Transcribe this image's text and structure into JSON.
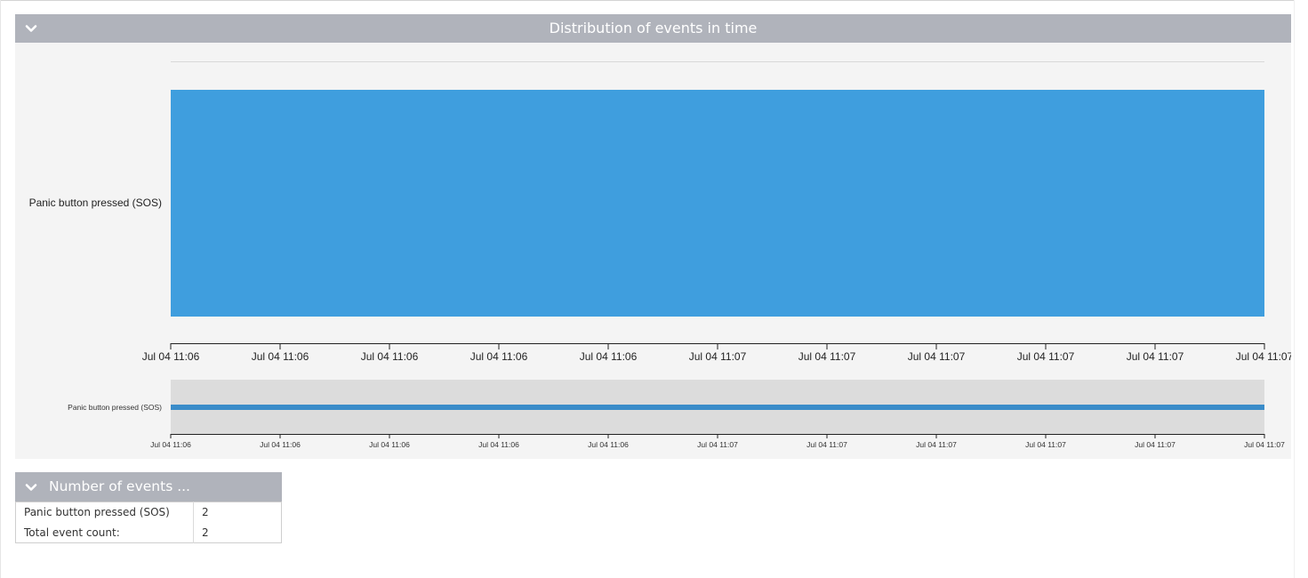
{
  "distribution_panel": {
    "title": "Distribution of events in time",
    "collapse_icon": "chevron-down-icon"
  },
  "chart_data": {
    "type": "bar",
    "orientation": "horizontal-timeline",
    "categories": [
      "Panic button pressed (SOS)"
    ],
    "series": [
      {
        "values": [
          1
        ]
      }
    ],
    "x_tick_labels": [
      "Jul 04 11:06",
      "Jul 04 11:06",
      "Jul 04 11:06",
      "Jul 04 11:06",
      "Jul 04 11:06",
      "Jul 04 11:07",
      "Jul 04 11:07",
      "Jul 04 11:07",
      "Jul 04 11:07",
      "Jul 04 11:07",
      "Jul 04 11:07"
    ],
    "navigator": {
      "categories": [
        "Panic button pressed (SOS)"
      ],
      "x_tick_labels": [
        "Jul 04 11:06",
        "Jul 04 11:06",
        "Jul 04 11:06",
        "Jul 04 11:06",
        "Jul 04 11:06",
        "Jul 04 11:07",
        "Jul 04 11:07",
        "Jul 04 11:07",
        "Jul 04 11:07",
        "Jul 04 11:07",
        "Jul 04 11:07"
      ]
    },
    "colors": {
      "bar": "#3f9ede",
      "navigator_bar": "#3a8cc9",
      "navigator_bg": "#dcdcdc",
      "axis": "#222222"
    }
  },
  "count_panel": {
    "title": "Number of events ...",
    "collapse_icon": "chevron-down-icon",
    "rows": [
      {
        "label": "Panic button pressed (SOS)",
        "value": "2"
      },
      {
        "label": "Total event count:",
        "value": "2"
      }
    ]
  },
  "colors": {
    "header_bg": "#b0b3bb",
    "header_text": "#ffffff",
    "panel_bg": "#f4f4f4"
  }
}
